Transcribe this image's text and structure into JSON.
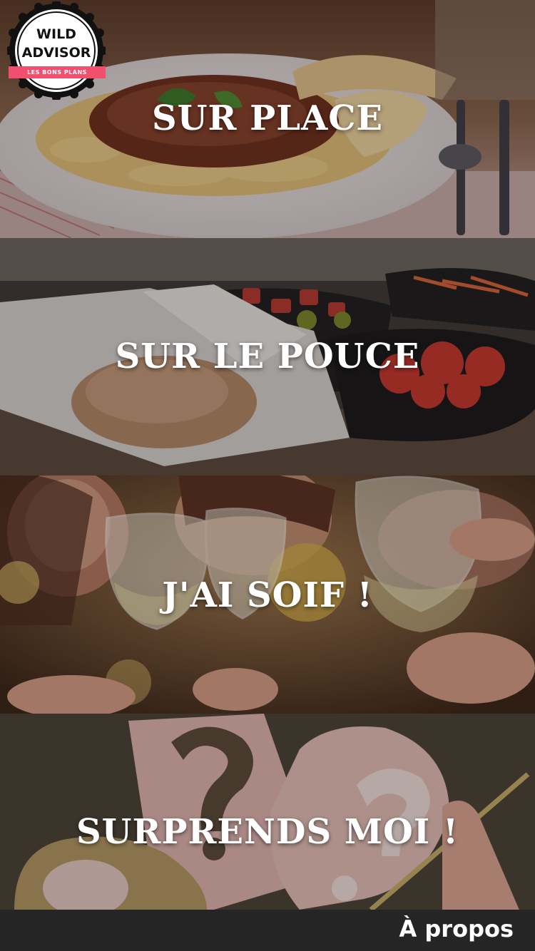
{
  "logo": {
    "line1": "WILD",
    "line2": "ADVISOR",
    "tagline": "LES BONS PLANS",
    "accent_color": "#f0506e"
  },
  "categories": [
    {
      "label": "SUR PLACE",
      "image_icon": "pasta-plate-photo"
    },
    {
      "label": "SUR LE POUCE",
      "image_icon": "takeaway-boxes-photo"
    },
    {
      "label": "J'AI SOIF !",
      "image_icon": "wine-glasses-toast-photo"
    },
    {
      "label": "SURPRENDS MOI !",
      "image_icon": "question-marks-photo"
    }
  ],
  "footer": {
    "about_label": "À propos"
  }
}
